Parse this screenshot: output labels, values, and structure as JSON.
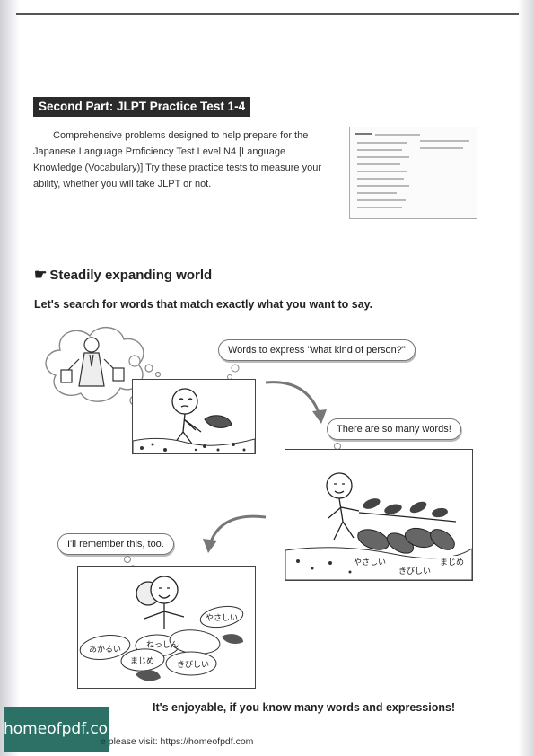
{
  "section": {
    "heading": "Second Part: JLPT Practice Test 1-4",
    "intro": "Comprehensive problems designed to help prepare for the Japanese Language Proficiency Test Level N4 [Language Knowledge (Vocabulary)] Try these practice tests to measure your ability, whether you will take JLPT or not."
  },
  "feature": {
    "title": "Steadily expanding world",
    "lead": "Let's search for words that match exactly what you want to say."
  },
  "comic": {
    "bubble1": "Words to express \"what kind of person?\"",
    "bubble2": "There are so many words!",
    "bubble3": "I'll remember this, too.",
    "panel2_words": [
      "やさしい",
      "きびしい",
      "まじめ"
    ],
    "panel3_words": [
      "やさしい",
      "あかるい",
      "ねっしん",
      "まじめ",
      "きびしい"
    ]
  },
  "closing": "It's enjoyable, if you know many words and expressions!",
  "watermark": {
    "logo_text": "homeofpdf.com",
    "visit_text": "e please visit: https://homeofpdf.com"
  }
}
